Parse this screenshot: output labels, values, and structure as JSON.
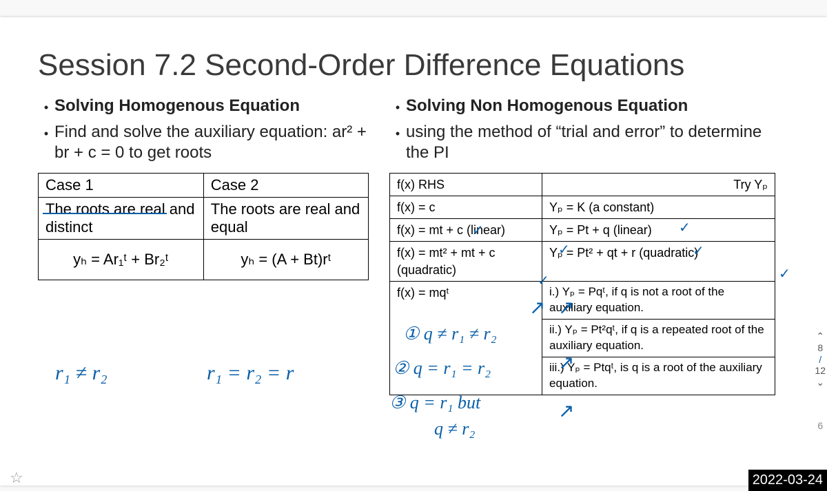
{
  "title": "Session 7.2 Second-Order Difference Equations",
  "left": {
    "b1": "Solving Homogenous Equation",
    "b2": "Find and solve the auxiliary equation: ar² + br + c = 0 to get roots",
    "case1_head": "Case 1",
    "case2_head": "Case 2",
    "case1_text": "The roots are real and distinct",
    "case2_text": "The roots are real and equal",
    "case1_y": "yₕ = Ar₁ᵗ + Br₂ᵗ",
    "case2_y": "yₕ = (A + Bt)rᵗ"
  },
  "right": {
    "b1": "Solving Non Homogenous Equation",
    "b2": "using the method of “trial and error” to determine the PI",
    "head_l": "f(x) RHS",
    "head_r": "Try Yₚ",
    "row1_l": "f(x) = c",
    "row1_r": "Yₚ = K (a constant)",
    "row2_l": "f(x) = mt + c (linear)",
    "row2_r": "Yₚ = Pt + q (linear)",
    "row3_l": "f(x) = mt² + mt + c (quadratic)",
    "row3_r": "Yₚ = Pt² + qt + r (quadratic)",
    "row4_l": "f(x) = mqᵗ",
    "row4_r1": "i.) Yₚ = Pqᵗ, if q is not a root of the auxiliary equation.",
    "row4_r2": "ii.) Yₚ = Pt²qᵗ, if q is a repeated root of the auxiliary equation.",
    "row4_r3": "iii.) Yₚ = Ptqᵗ, is q is a root of the auxiliary equation."
  },
  "hand": {
    "h1": "r₁ ≠ r₂",
    "h2": "r₁ = r₂ = r",
    "h3": "① q ≠ r₁ ≠ r₂",
    "h4": "② q = r₁ = r₂",
    "h5": "③ q = r₁ but",
    "h6": "q ≠ r₂"
  },
  "side": {
    "up": "⌃",
    "n8": "8",
    "slash": "/",
    "n12": "12",
    "down": "⌄",
    "n6": "6"
  },
  "timestamp": "2022-03-24"
}
